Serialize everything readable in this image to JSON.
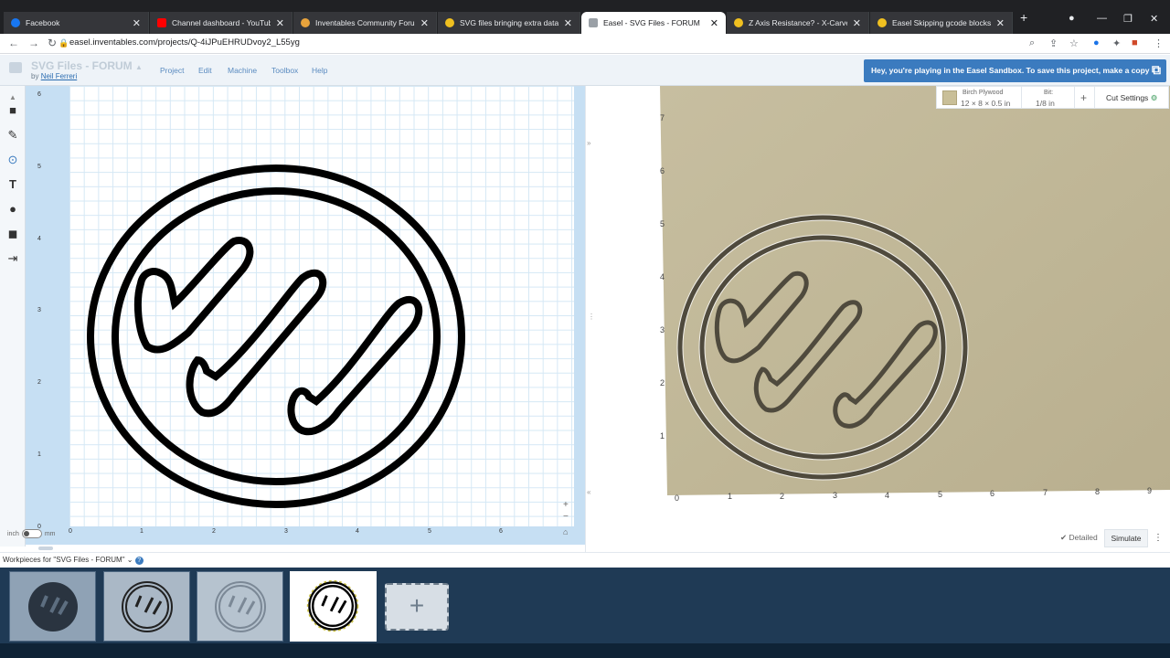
{
  "browser": {
    "tabs": [
      {
        "title": "Facebook",
        "favicon_color": "#1877f2"
      },
      {
        "title": "Channel dashboard - YouTube S",
        "favicon_color": "#ff0000"
      },
      {
        "title": "Inventables Community Forum",
        "favicon_color": "#e8a33c"
      },
      {
        "title": "SVG files bringing extra data - E",
        "favicon_color": "#f0c020"
      },
      {
        "title": "Easel - SVG Files - FORUM",
        "favicon_color": "#9aa0a6"
      },
      {
        "title": "Z Axis Resistance? - X-Carve / Tr",
        "favicon_color": "#f0c020"
      },
      {
        "title": "Easel Skipping gcode blocks - E",
        "favicon_color": "#f0c020"
      }
    ],
    "url": "easel.inventables.com/projects/Q-4iJPuEHRUDvoy2_L55yg"
  },
  "easel": {
    "project_title": "SVG Files - FORUM",
    "by_prefix": "by",
    "author": "Neil Ferreri",
    "menu": [
      "Project",
      "Edit",
      "Machine",
      "Toolbox",
      "Help"
    ],
    "sandbox_banner": "Hey, you're playing in the Easel Sandbox. To save this project, make a copy"
  },
  "design": {
    "y_ticks": [
      "6",
      "5",
      "4",
      "3",
      "2",
      "1",
      "0"
    ],
    "x_ticks": [
      "0",
      "1",
      "2",
      "3",
      "4",
      "5",
      "6"
    ],
    "unit_left": "inch",
    "unit_right": "mm"
  },
  "preview": {
    "material_name": "Birch Plywood",
    "material_size": "12 × 8 × 0.5 in",
    "bit_label": "Bit:",
    "bit_value": "1/8 in",
    "cut_settings": "Cut Settings",
    "y_ticks": [
      "7",
      "6",
      "5",
      "4",
      "3",
      "2",
      "1"
    ],
    "x_ticks": [
      "0",
      "1",
      "2",
      "3",
      "4",
      "5",
      "6",
      "7",
      "8",
      "9"
    ],
    "detailed": "Detailed",
    "simulate": "Simulate"
  },
  "workpieces": {
    "header": "Workpieces for \"SVG Files - FORUM\""
  },
  "colors": {
    "accent": "#3b7bbf",
    "canvas_bg": "#c6dff3",
    "wood": "#c4bb98",
    "tray": "#1f3a55"
  }
}
